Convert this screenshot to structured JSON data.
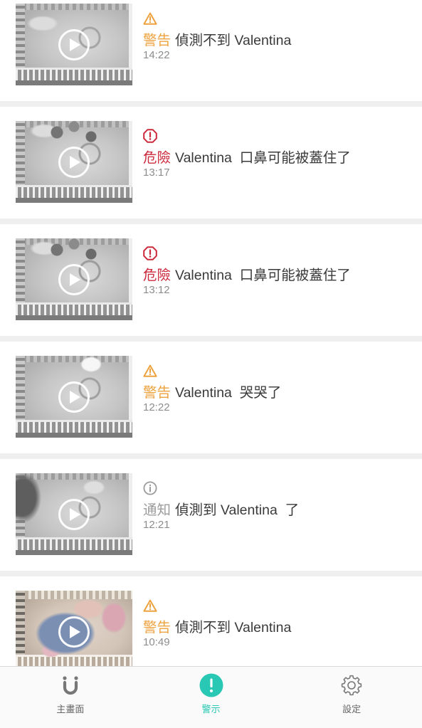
{
  "colors": {
    "accent": "#28c8b4",
    "text": "#3a3a3a",
    "muted": "#8c8c8c",
    "tab_inactive": "#777777"
  },
  "alerts": {
    "items": [
      {
        "icon": "warning-icon",
        "color": "#eea23e",
        "label": "警告",
        "message": "偵測不到 Valentina",
        "time": "14:22"
      },
      {
        "icon": "danger-icon",
        "color": "#cc2a3c",
        "label": "危險",
        "message": "Valentina  口鼻可能被蓋住了",
        "time": "13:17"
      },
      {
        "icon": "danger-icon",
        "color": "#cc2a3c",
        "label": "危險",
        "message": "Valentina  口鼻可能被蓋住了",
        "time": "13:12"
      },
      {
        "icon": "warning-icon",
        "color": "#eea23e",
        "label": "警告",
        "message": "Valentina  哭哭了",
        "time": "12:22"
      },
      {
        "icon": "info-icon",
        "color": "#9b9b9b",
        "label": "通知",
        "message": "偵測到 Valentina  了",
        "time": "12:21"
      },
      {
        "icon": "warning-icon",
        "color": "#eea23e",
        "label": "警告",
        "message": "偵測不到 Valentina",
        "time": "10:49"
      }
    ]
  },
  "tabbar": {
    "tabs": [
      {
        "icon": "home-icon",
        "label": "主畫面",
        "active": false
      },
      {
        "icon": "alert-icon",
        "label": "警示",
        "active": true
      },
      {
        "icon": "settings-icon",
        "label": "設定",
        "active": false
      }
    ]
  }
}
